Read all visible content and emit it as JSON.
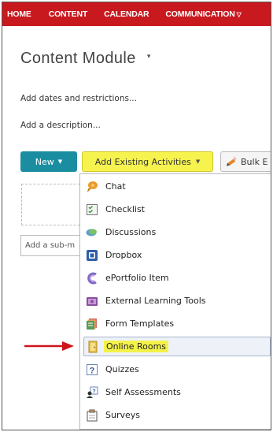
{
  "navbar": {
    "items": [
      {
        "label": "HOME"
      },
      {
        "label": "CONTENT"
      },
      {
        "label": "CALENDAR"
      },
      {
        "label": "COMMUNICATION",
        "caret": "▽"
      }
    ],
    "background": "#c8191f"
  },
  "module": {
    "title": "Content Module",
    "title_caret": "▾",
    "add_dates": "Add dates and restrictions...",
    "add_description": "Add a description..."
  },
  "toolbar": {
    "new_label": "New",
    "new_caret": "▼",
    "add_existing_label": "Add Existing Activities",
    "add_existing_caret": "▼",
    "bulk_label": "Bulk E"
  },
  "sub_module_input": {
    "placeholder": "Add a sub-m"
  },
  "menu": {
    "items": [
      {
        "label": "Chat",
        "icon": "chat-icon"
      },
      {
        "label": "Checklist",
        "icon": "checklist-icon"
      },
      {
        "label": "Discussions",
        "icon": "discussions-icon"
      },
      {
        "label": "Dropbox",
        "icon": "dropbox-icon"
      },
      {
        "label": "ePortfolio Item",
        "icon": "eportfolio-icon"
      },
      {
        "label": "External Learning Tools",
        "icon": "external-tools-icon"
      },
      {
        "label": "Form Templates",
        "icon": "form-templates-icon"
      },
      {
        "label": "Online Rooms",
        "icon": "online-rooms-icon",
        "highlighted": true
      },
      {
        "label": "Quizzes",
        "icon": "quizzes-icon"
      },
      {
        "label": "Self Assessments",
        "icon": "self-assessments-icon"
      },
      {
        "label": "Surveys",
        "icon": "surveys-icon"
      }
    ]
  },
  "colors": {
    "accent_new": "#1a8ea0",
    "highlight_yellow": "#f6f34e",
    "arrow_red": "#d0141b"
  }
}
